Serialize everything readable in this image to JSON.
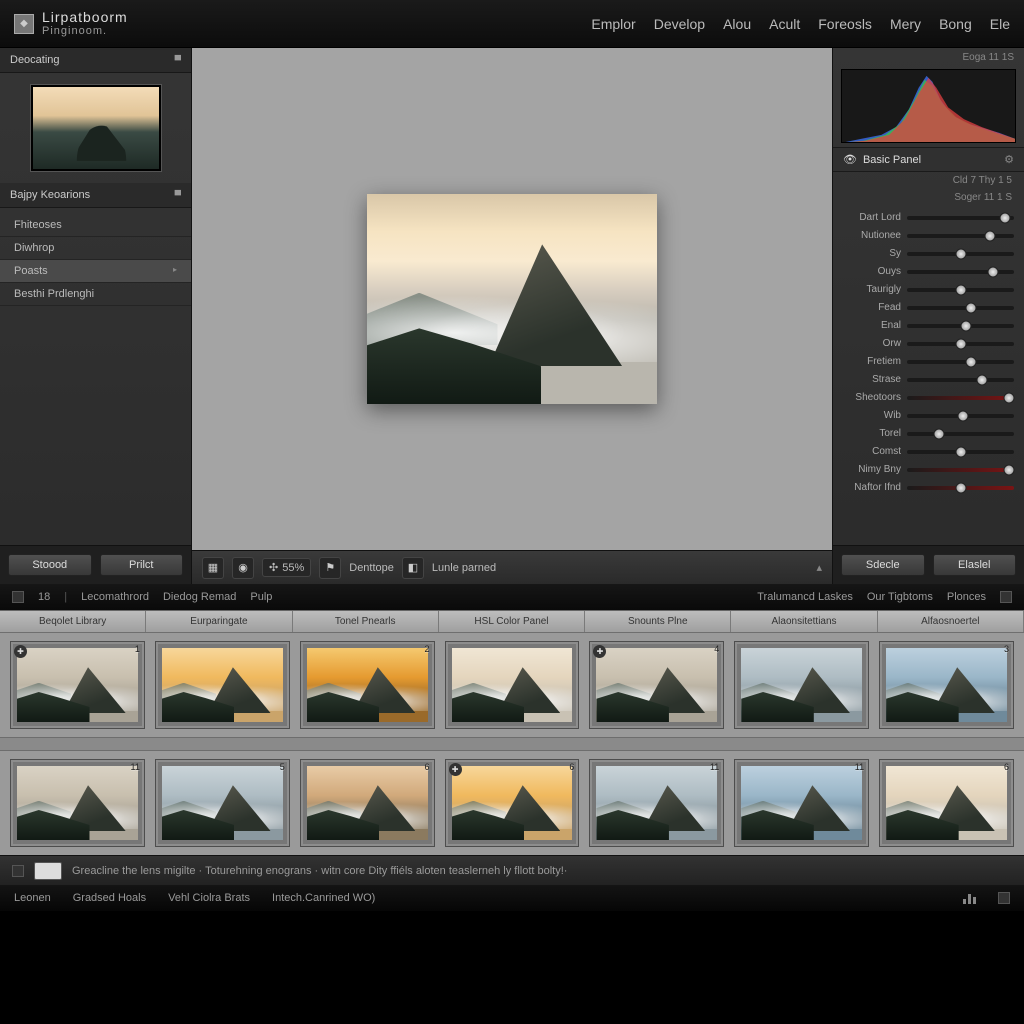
{
  "brand": {
    "line1": "Lirpatboorm",
    "line2": "Pinginoom."
  },
  "topnav": [
    "Emplor",
    "Develop",
    "Alou",
    "Acult",
    "Foreosls",
    "Mery",
    "Bong",
    "Ele"
  ],
  "left": {
    "nav_header": "Deocating",
    "presets_header": "Bajpy Keoarions",
    "items": [
      {
        "label": "Fhiteoses",
        "active": false
      },
      {
        "label": "Diwhrop",
        "active": false
      },
      {
        "label": "Poasts",
        "active": true
      },
      {
        "label": "Besthi Prdlenghi",
        "active": false
      }
    ],
    "btn_left": "Stoood",
    "btn_right": "Prilct"
  },
  "center_toolbar": {
    "zoom": "55%",
    "btn1": "Denttope",
    "btn2": "Lunle parned"
  },
  "right": {
    "header_small": "Eoga 11 1S",
    "panel_title": "Basic Panel",
    "meta1": "Cld 7 Thy 1 5",
    "meta2": "Soger 11 1 S",
    "sliders": [
      {
        "label": "Dart Lord",
        "pos": 92
      },
      {
        "label": "Nutionee",
        "pos": 78
      },
      {
        "label": "Sy",
        "pos": 50
      },
      {
        "label": "Ouys",
        "pos": 80
      },
      {
        "label": "Taurigly",
        "pos": 50
      },
      {
        "label": "Fead",
        "pos": 60
      },
      {
        "label": "Enal",
        "pos": 55
      },
      {
        "label": "Orw",
        "pos": 50
      },
      {
        "label": "Fretiem",
        "pos": 60
      },
      {
        "label": "Strase",
        "pos": 70
      },
      {
        "label": "Sheotoors",
        "pos": 95,
        "red": true
      },
      {
        "label": "Wib",
        "pos": 52
      },
      {
        "label": "Torel",
        "pos": 30
      },
      {
        "label": "Comst",
        "pos": 50
      },
      {
        "label": "Nimy Bny",
        "pos": 95,
        "red": true
      },
      {
        "label": "Naftor Ifnd",
        "pos": 50,
        "red": true
      }
    ],
    "btn_left": "Sdecle",
    "btn_right": "Elaslel"
  },
  "midstrip": {
    "left": [
      "18",
      "Lecomathrord",
      "Diedog Remad",
      "Pulp"
    ],
    "right": [
      "Tralumancd Laskes",
      "Our Tigbtoms",
      "Plonces"
    ]
  },
  "film_tabs": [
    "Beqolet Library",
    "Eurparingate",
    "Tonel Pnearls",
    "HSL Color Panel",
    "Snounts Plne",
    "Alaonsitettians",
    "Alfaosnoertel"
  ],
  "thumbs_row1": [
    {
      "n": "1",
      "variant": "v-neutral",
      "badge": true
    },
    {
      "n": "",
      "variant": "v-warm"
    },
    {
      "n": "2",
      "variant": "v-gold"
    },
    {
      "n": "",
      "variant": "v-soft"
    },
    {
      "n": "4",
      "variant": "v-neutral",
      "badge": true
    },
    {
      "n": "",
      "variant": "v-cool"
    },
    {
      "n": "3",
      "variant": "v-blue"
    }
  ],
  "thumbs_row2": [
    {
      "n": "11",
      "variant": "v-neutral"
    },
    {
      "n": "5",
      "variant": "v-cool"
    },
    {
      "n": "6",
      "variant": "v-dusk"
    },
    {
      "n": "6",
      "variant": "v-warm",
      "badge": true
    },
    {
      "n": "11",
      "variant": "v-cool"
    },
    {
      "n": "11",
      "variant": "v-blue"
    },
    {
      "n": "6",
      "variant": "v-soft"
    }
  ],
  "hint": "Greacline the lens migilte · Toturehning enograns · witn core Dity ffiéls aloten teaslerneh ly fllott bolty!·",
  "status": [
    "Leonen",
    "Gradsed Hoals",
    "Vehl Ciolra Brats",
    "Intech.Canrined WO)"
  ]
}
